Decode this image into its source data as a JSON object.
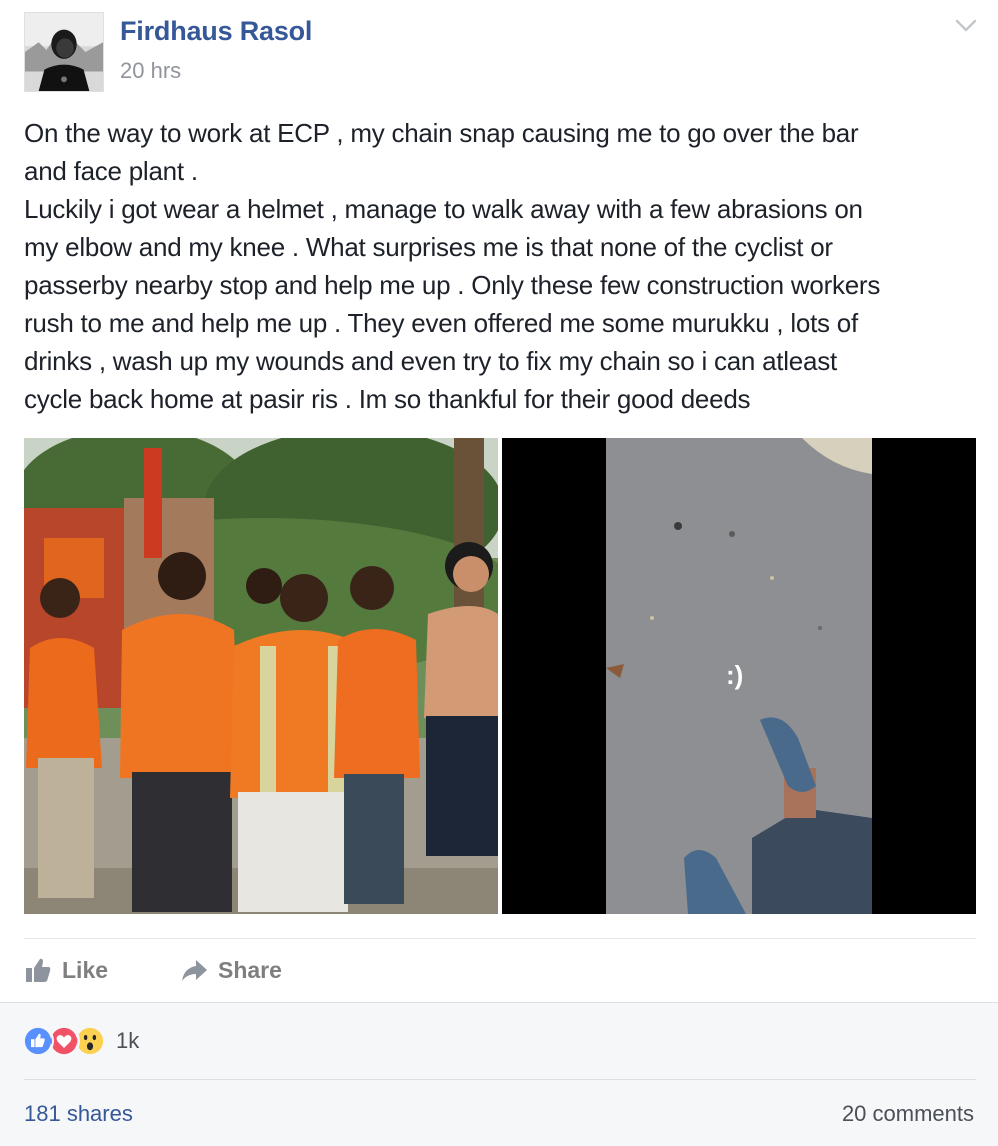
{
  "post": {
    "author": "Firdhaus Rasol",
    "timestamp": "20 hrs",
    "text_lines": [
      "On the way to work at ECP , my chain snap causing me to go over the bar",
      "and face plant .",
      "Luckily i got wear a helmet , manage to walk away with a few abrasions on",
      "my elbow and my knee . What surprises me is that none of the cyclist or",
      "passerby nearby stop and help me up . Only these few construction workers",
      "rush to me and help me up . They even offered me some murukku , lots of",
      "drinks , wash up my wounds and even try to fix my chain so i can atleast",
      "cycle back home at pasir ris . Im so thankful for their good deeds"
    ],
    "photo_right_caption": ":)"
  },
  "actions": {
    "like_label": "Like",
    "share_label": "Share"
  },
  "footer": {
    "reaction_count": "1k",
    "shares": "181 shares",
    "comments": "20 comments"
  },
  "colors": {
    "link_blue": "#365899",
    "like_blue": "#5890ff",
    "love_red": "#f25268",
    "wow_yellow": "#fcd050",
    "footer_bg": "#f6f7f9",
    "action_gray": "#7f7f7f"
  },
  "icons": {
    "avatar": "profile-avatar",
    "menu": "chevron-down-icon",
    "like": "thumbs-up-icon",
    "share": "share-arrow-icon",
    "reactions": [
      "like-reaction-icon",
      "love-reaction-icon",
      "wow-reaction-icon"
    ]
  }
}
